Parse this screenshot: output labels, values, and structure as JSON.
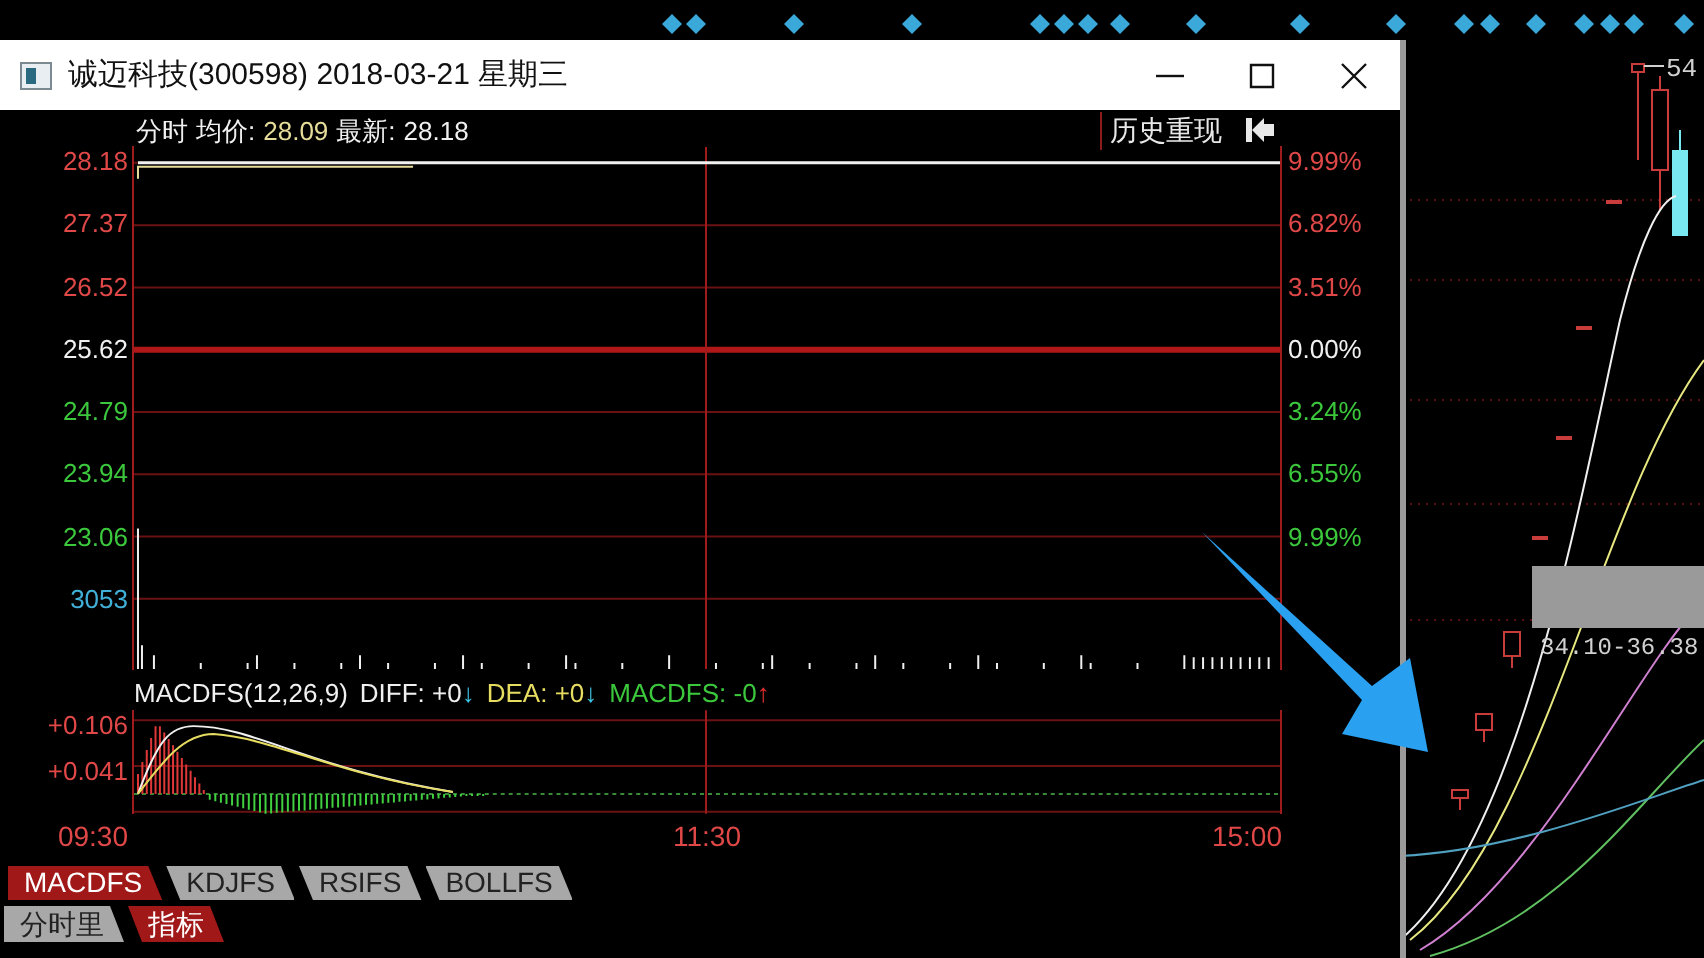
{
  "background_chart": {
    "price_mark": "54",
    "range_label": "34.10-36.38"
  },
  "window": {
    "title": "诚迈科技(300598) 2018-03-21 星期三"
  },
  "quote_bar": {
    "items": [
      {
        "label": "分时"
      },
      {
        "label": "均价:",
        "value": "28.09",
        "color": "#e6dc9a"
      },
      {
        "label": "最新:",
        "value": "28.18",
        "color": "#f0f0f0"
      }
    ],
    "history_button": "历史重现"
  },
  "price_levels": [
    {
      "price": "28.18",
      "change": "9.99%",
      "color": "#e04848"
    },
    {
      "price": "27.37",
      "change": "6.82%",
      "color": "#e04848"
    },
    {
      "price": "26.52",
      "change": "3.51%",
      "color": "#e04848"
    },
    {
      "price": "25.62",
      "change": "0.00%",
      "color": "#f0f0f0"
    },
    {
      "price": "24.79",
      "change": "3.24%",
      "color": "#3cc83c"
    },
    {
      "price": "23.94",
      "change": "6.55%",
      "color": "#3cc83c"
    },
    {
      "price": "23.06",
      "change": "9.99%",
      "color": "#3cc83c"
    }
  ],
  "volume_label": "3053",
  "macd": {
    "title": "MACDFS(12,26,9)",
    "legend": [
      {
        "text": "DIFF: +0",
        "color": "#f0f0f0"
      },
      {
        "text": "↓",
        "color": "#40c8e8"
      },
      {
        "text": "DEA: +0",
        "color": "#e6dc60"
      },
      {
        "text": "↓",
        "color": "#40c8e8"
      },
      {
        "text": "MACDFS: -0",
        "color": "#3cc83c"
      },
      {
        "text": "↑",
        "color": "#e83030"
      }
    ],
    "levels": [
      "+0.106",
      "+0.041"
    ]
  },
  "time_axis": [
    "09:30",
    "11:30",
    "15:00"
  ],
  "indicator_tabs": [
    {
      "label": "MACDFS",
      "selected": true
    },
    {
      "label": "KDJFS",
      "selected": false
    },
    {
      "label": "RSIFS",
      "selected": false
    },
    {
      "label": "BOLLFS",
      "selected": false
    }
  ],
  "view_tabs": [
    {
      "label": "分时里",
      "selected": false
    },
    {
      "label": "指标",
      "selected": true
    }
  ]
}
